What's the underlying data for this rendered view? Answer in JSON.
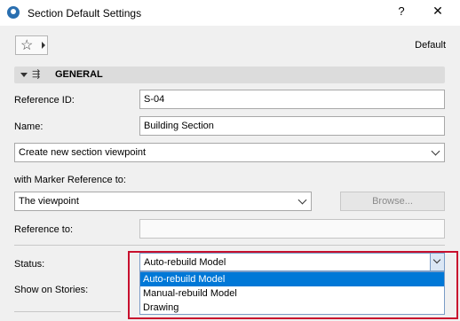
{
  "window": {
    "title": "Section Default Settings",
    "help": "?",
    "close": "✕"
  },
  "toolbar": {
    "favorites_star": "☆",
    "default_label": "Default"
  },
  "section": {
    "title": "GENERAL",
    "icon": "⇶"
  },
  "form": {
    "reference_id_label": "Reference ID:",
    "reference_id_value": "S-04",
    "name_label": "Name:",
    "name_value": "Building Section",
    "viewpoint_select": "Create new section viewpoint",
    "marker_ref_label": "with Marker Reference to:",
    "marker_ref_select": "The viewpoint",
    "browse_label": "Browse...",
    "reference_to_label": "Reference to:",
    "reference_to_value": "",
    "status_label": "Status:",
    "status_value": "Auto-rebuild Model",
    "show_on_stories_label": "Show on Stories:"
  },
  "status_options": [
    {
      "label": "Auto-rebuild Model",
      "selected": true
    },
    {
      "label": "Manual-rebuild Model",
      "selected": false
    },
    {
      "label": "Drawing",
      "selected": false
    }
  ],
  "colors": {
    "selection": "#0078d7",
    "highlight": "#c8102e"
  }
}
